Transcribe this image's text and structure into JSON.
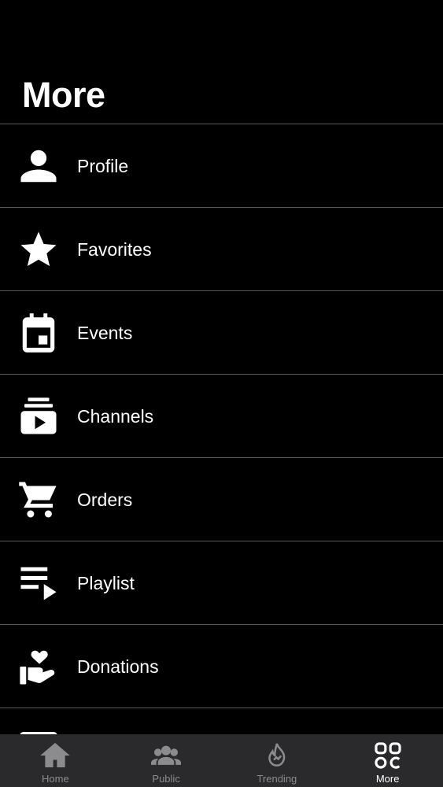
{
  "header": {
    "title": "More"
  },
  "menu": {
    "items": [
      {
        "label": "Profile",
        "icon": "person-icon"
      },
      {
        "label": "Favorites",
        "icon": "star-icon"
      },
      {
        "label": "Events",
        "icon": "calendar-icon"
      },
      {
        "label": "Channels",
        "icon": "subscriptions-icon"
      },
      {
        "label": "Orders",
        "icon": "cart-icon"
      },
      {
        "label": "Playlist",
        "icon": "playlist-play-icon"
      },
      {
        "label": "Donations",
        "icon": "volunteer-hand-heart-icon"
      }
    ]
  },
  "tabbar": {
    "tabs": [
      {
        "label": "Home",
        "icon": "home-icon",
        "active": false
      },
      {
        "label": "Public",
        "icon": "group-icon",
        "active": false
      },
      {
        "label": "Trending",
        "icon": "flame-icon",
        "active": false
      },
      {
        "label": "More",
        "icon": "grid-icon",
        "active": true
      }
    ]
  },
  "colors": {
    "background": "#000000",
    "divider": "#5a5a5a",
    "tabbar_bg": "#2a2a2c",
    "tab_inactive": "#8c8c8e",
    "tab_active": "#ffffff"
  }
}
